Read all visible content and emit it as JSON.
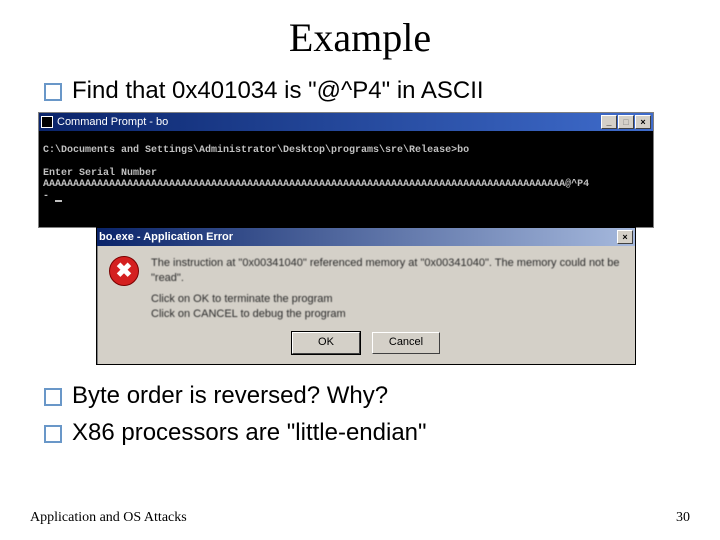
{
  "title": "Example",
  "bullets": {
    "top1": "Find that 0x401034 is \"@^P4\" in ASCII",
    "bottom1": "Byte order is reversed? Why?",
    "bottom2": "X86 processors are \"little-endian\""
  },
  "cmd": {
    "window_title": "Command Prompt - bo",
    "path_line": "C:\\Documents and Settings\\Administrator\\Desktop\\programs\\sre\\Release>bo",
    "blank": "",
    "prompt_line": "Enter Serial Number",
    "input_line": "AAAAAAAAAAAAAAAAAAAAAAAAAAAAAAAAAAAAAAAAAAAAAAAAAAAAAAAAAAAAAAAAAAAAAAAAAAAAAAAAAAAAAAA@^P4",
    "min_label": "_",
    "max_label": "□",
    "close_label": "×"
  },
  "dialog": {
    "title": "bo.exe - Application Error",
    "line1": "The instruction at \"0x00341040\" referenced memory at \"0x00341040\". The memory could not be \"read\".",
    "line2": "Click on OK to terminate the program",
    "line3": "Click on CANCEL to debug the program",
    "ok_label": "OK",
    "cancel_label": "Cancel",
    "close_label": "×",
    "icon_glyph": "✖"
  },
  "footer": {
    "left": "Application and OS Attacks",
    "right": "30"
  }
}
